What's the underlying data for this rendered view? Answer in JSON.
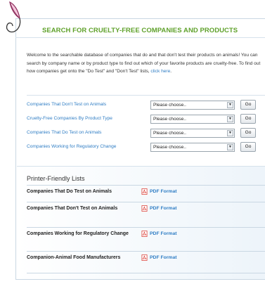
{
  "header": {
    "logo_icon": "feather-logo-icon",
    "title": "SEARCH FOR CRUELTY-FREE COMPANIES AND PRODUCTS"
  },
  "intro": {
    "text": "Welcome to the searchable database of companies that do and that don't test their products on animals! You can search by company name or by product type to find out which of your favorite products are cruelty-free. To find out how companies get onto the \"Do Test\" and \"Don't Test\" lists, ",
    "link_text": "click here",
    "suffix": "."
  },
  "search_rows": [
    {
      "label": "Companies That Don't Test on Animals",
      "select_value": "Please choose..",
      "go_label": "Go"
    },
    {
      "label": "Cruelty-Free Companies By Product Type",
      "select_value": "Please choose..",
      "go_label": "Go"
    },
    {
      "label": "Companies That Do Test on Animals",
      "select_value": "Please choose..",
      "go_label": "Go"
    },
    {
      "label": "Companies Working for Regulatory Change",
      "select_value": "Please choose..",
      "go_label": "Go"
    }
  ],
  "printer_lists": {
    "title": "Printer-Friendly Lists",
    "items": [
      {
        "name": "Companies That Do Test on Animals",
        "link": "PDF Format",
        "icon": "pdf-icon"
      },
      {
        "name": "Companies That Don't Test on Animals",
        "link": "PDF Format",
        "icon": "pdf-icon"
      },
      {
        "name": "Companies Working for Regulatory Change",
        "link": "PDF Format",
        "icon": "pdf-icon"
      },
      {
        "name": "Companion-Animal Food Manufacturers",
        "link": "PDF Format",
        "icon": "pdf-icon"
      }
    ]
  },
  "colors": {
    "title_green": "#5fa12b",
    "link_blue": "#2f7dc4",
    "pdf_red": "#d9342b"
  }
}
